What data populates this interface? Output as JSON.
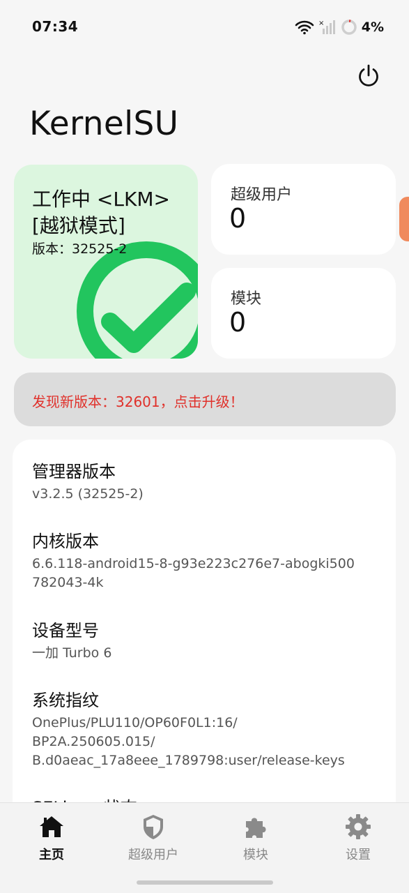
{
  "status_bar": {
    "time": "07:34",
    "battery": "4%",
    "icons": [
      "wifi-icon",
      "signal-off-icon",
      "battery-ring-icon"
    ]
  },
  "header": {
    "title": "KernelSU",
    "power_icon": "power-icon"
  },
  "status_card": {
    "line1": "工作中 <LKM>",
    "line2": "[越狱模式]",
    "version": "版本：32525-2",
    "accent_color": "#22c55e",
    "background_color": "#dcf6df"
  },
  "superuser_card": {
    "label": "超级用户",
    "count": "0"
  },
  "modules_card": {
    "label": "模块",
    "count": "0"
  },
  "update_banner": {
    "text": "发现新版本：32601，点击升级！",
    "color": "#e0302a"
  },
  "info": {
    "items": [
      {
        "title": "管理器版本",
        "lines": [
          "v3.2.5 (32525-2)"
        ]
      },
      {
        "title": "内核版本",
        "lines": [
          "6.6.118-android15-8-g93e223c276e7-abogki500",
          "782043-4k"
        ]
      },
      {
        "title": "设备型号",
        "lines": [
          "一加 Turbo 6"
        ]
      },
      {
        "title": "系统指纹",
        "lines": [
          "OnePlus/PLU110/OP60F0L1:16/",
          "BP2A.250605.015/",
          "B.d0aeac_17a8eee_1789798:user/release-keys"
        ]
      },
      {
        "title": "SELinux 状态",
        "lines": []
      }
    ]
  },
  "bottom_nav": {
    "items": [
      {
        "label": "主页",
        "icon": "home-icon",
        "active": true
      },
      {
        "label": "超级用户",
        "icon": "shield-icon",
        "active": false
      },
      {
        "label": "模块",
        "icon": "puzzle-icon",
        "active": false
      },
      {
        "label": "设置",
        "icon": "gear-icon",
        "active": false
      }
    ]
  }
}
